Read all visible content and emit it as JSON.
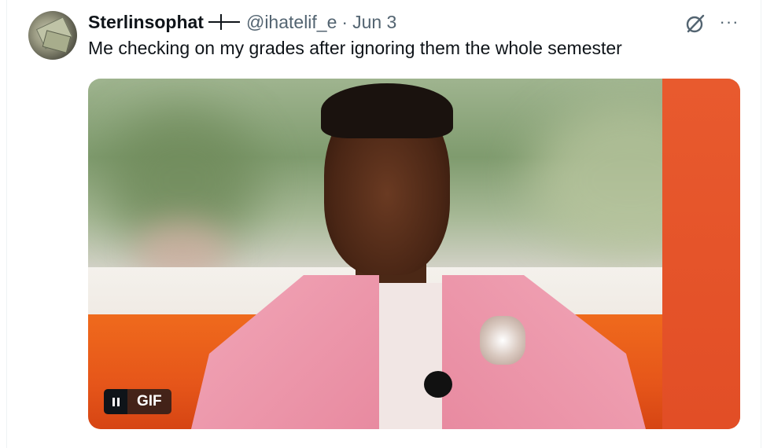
{
  "tweet": {
    "author_name": "Sterlinsophat",
    "handle": "@ihatelif_e",
    "separator": "·",
    "date": "Jun 3",
    "text": "Me checking on my grades after ignoring them the whole semester",
    "more_label": "···"
  },
  "media": {
    "badge_label": "GIF"
  },
  "icons": {
    "avatar": "avatar-money-icon",
    "name_decoration": "cross-icon",
    "grok": "grok-icon",
    "more": "more-icon",
    "pause": "pause-icon"
  }
}
